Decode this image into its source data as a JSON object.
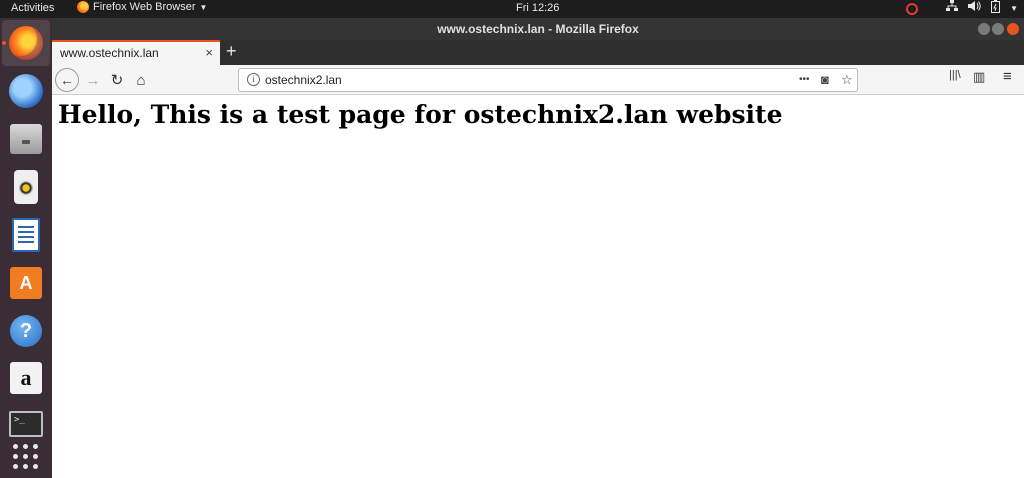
{
  "topbar": {
    "activities": "Activities",
    "app_name": "Firefox Web Browser",
    "clock": "Fri 12:26",
    "tray": {
      "icons": [
        "record-icon",
        "network-icon",
        "volume-icon",
        "battery-icon",
        "menu-arrow-icon"
      ],
      "record_color": "#e23b2e"
    }
  },
  "dock": {
    "apps": [
      "firefox",
      "thunderbird",
      "files",
      "rhythmbox",
      "libreoffice-writer",
      "ubuntu-software",
      "help",
      "amazon",
      "terminal",
      "show-applications"
    ],
    "accent": "#e95420"
  },
  "window": {
    "title": "www.ostechnix.lan - Mozilla Firefox"
  },
  "tab": {
    "label": "www.ostechnix.lan",
    "close_glyph": "×",
    "new_tab_glyph": "+"
  },
  "nav": {
    "back_glyph": "←",
    "forward_glyph": "→",
    "reload_glyph": "↻",
    "home_glyph": "⌂",
    "url": "ostechnix2.lan",
    "more_glyph": "•••",
    "pocket_glyph": "◙",
    "bookmark_glyph": "☆",
    "library_glyph": "|||\\",
    "sidebar_glyph": "▥",
    "menu_glyph": "≡"
  },
  "page": {
    "heading": "Hello, This is a test page for ostechnix2.lan website"
  }
}
